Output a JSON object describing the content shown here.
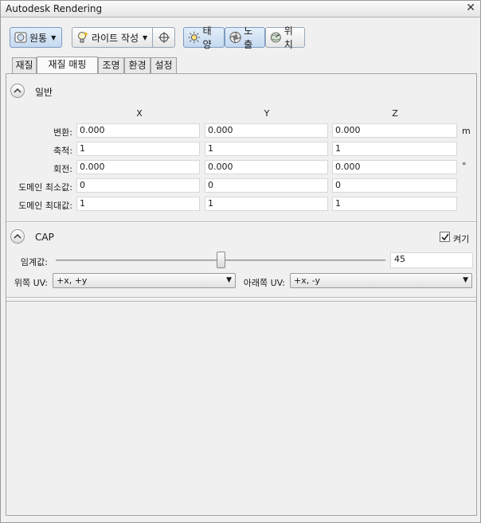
{
  "window": {
    "title": "Autodesk Rendering",
    "close_label": "✕"
  },
  "toolbar": {
    "render_label": "원통",
    "light_label": "라이트 작성",
    "sun_label": "태양",
    "exposure_label": "노출",
    "location_label": "위치"
  },
  "tabs": [
    "재질",
    "재질 매핑",
    "조명",
    "환경",
    "설정"
  ],
  "general": {
    "title": "일반",
    "columns": [
      "X",
      "Y",
      "Z"
    ],
    "rows": [
      {
        "label": "변환:",
        "x": "0.000",
        "y": "0.000",
        "z": "0.000",
        "unit": "m"
      },
      {
        "label": "축척:",
        "x": "1",
        "y": "1",
        "z": "1",
        "unit": ""
      },
      {
        "label": "회전:",
        "x": "0.000",
        "y": "0.000",
        "z": "0.000",
        "unit": "°"
      },
      {
        "label": "도메인 최소값:",
        "x": "0",
        "y": "0",
        "z": "0",
        "unit": ""
      },
      {
        "label": "도메인 최대값:",
        "x": "1",
        "y": "1",
        "z": "1",
        "unit": ""
      }
    ]
  },
  "cap": {
    "title": "CAP",
    "enabled_label": "켜기",
    "enabled": true,
    "threshold_label": "임계값:",
    "threshold_value": "45",
    "threshold_fraction": 0.5,
    "top_uv_label": "위쪽 UV:",
    "top_uv_value": "+x, +y",
    "bottom_uv_label": "아래쪽 UV:",
    "bottom_uv_value": "+x, -y"
  }
}
